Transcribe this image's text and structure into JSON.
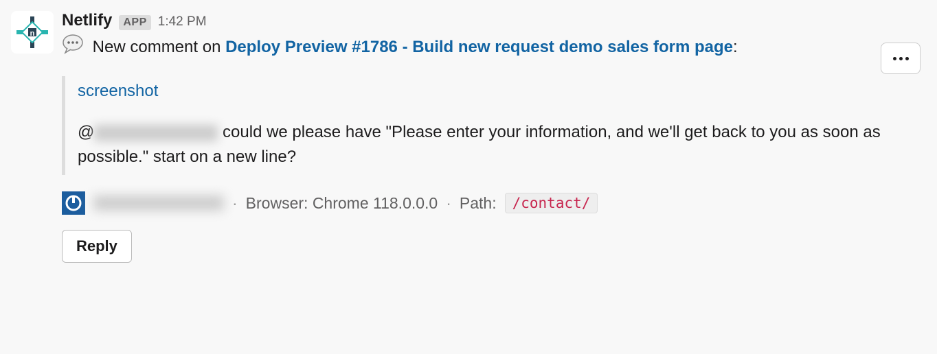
{
  "message": {
    "author": "Netlify",
    "badge": "APP",
    "timestamp": "1:42 PM",
    "body_prefix": "New comment on ",
    "body_link": "Deploy Preview #1786 - Build new request demo sales form page",
    "body_suffix": ":"
  },
  "attachment": {
    "title": "screenshot",
    "mention_prefix": "@",
    "body_text": " could we please have \"Please enter your information, and we'll get back to you as soon as possible.\" start on a new line?"
  },
  "footer": {
    "browser_label": "Browser: ",
    "browser_value": "Chrome 118.0.0.0",
    "path_label": "Path: ",
    "path_value": "/contact/"
  },
  "actions": {
    "reply_label": "Reply"
  }
}
